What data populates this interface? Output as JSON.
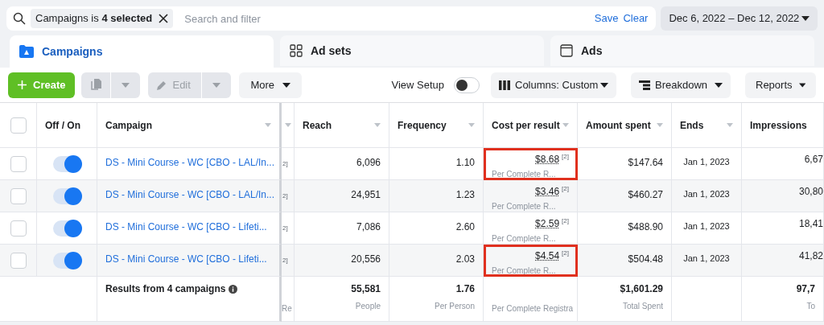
{
  "filter_bar": {
    "chip_label": "Campaigns is ",
    "chip_value": "4 selected",
    "placeholder": "Search and filter",
    "save": "Save",
    "clear": "Clear",
    "date_range": "Dec 6, 2022 – Dec 12, 2022"
  },
  "tabs": [
    {
      "label": "Campaigns",
      "selected": true
    },
    {
      "label": "Ad sets",
      "selected": false
    },
    {
      "label": "Ads",
      "selected": false
    }
  ],
  "toolbar": {
    "create": "Create",
    "edit": "Edit",
    "more": "More",
    "view_setup": {
      "label": "View Setup",
      "on": false
    },
    "columns": "Columns: Custom",
    "breakdown": "Breakdown",
    "reports": "Reports"
  },
  "table": {
    "select_all": {
      "checked": false
    },
    "columns": [
      "Off / On",
      "Campaign",
      "Reach",
      "Frequency",
      "Cost per result",
      "Amount spent",
      "Ends",
      "Impressions"
    ],
    "rows": [
      {
        "checked": false,
        "on": true,
        "campaign": "DS - Mini Course - WC [CBO - LAL/In...",
        "column_3": "2]",
        "reach": "6,096",
        "frequency": "1.10",
        "cost": "$8.68",
        "cost_note": "[2]",
        "cost_sub": "Per Complete R...",
        "highlighted": true,
        "amount": "$147.64",
        "ends": "Jan 1, 2023",
        "impressions": "6,67"
      },
      {
        "checked": false,
        "on": true,
        "campaign": "DS - Mini Course - WC [CBO - LAL/In...",
        "column_3": "2]",
        "reach": "24,951",
        "frequency": "1.23",
        "cost": "$3.46",
        "cost_note": "[2]",
        "cost_sub": "Per Complete R...",
        "highlighted": false,
        "amount": "$460.27",
        "ends": "Jan 1, 2023",
        "impressions": "30,80"
      },
      {
        "checked": false,
        "on": true,
        "campaign": "DS - Mini Course - WC [CBO - Lifeti...",
        "column_3": "2]",
        "reach": "7,086",
        "frequency": "2.60",
        "cost": "$2.59",
        "cost_note": "[2]",
        "cost_sub": "Per Complete R...",
        "highlighted": false,
        "amount": "$488.90",
        "ends": "Jan 1, 2023",
        "impressions": "18,41"
      },
      {
        "checked": false,
        "on": true,
        "campaign": "DS - Mini Course - WC [CBO - Lifeti...",
        "column_3": "2]",
        "reach": "20,556",
        "frequency": "2.03",
        "cost": "$4.54",
        "cost_note": "[2]",
        "cost_sub": "Per Complete R...",
        "highlighted": true,
        "amount": "$504.48",
        "ends": "Jan 1, 2023",
        "impressions": "41,82"
      }
    ],
    "footer": {
      "label": "Results from 4 campaigns",
      "column_3": "Re",
      "reach": "55,581",
      "reach_sub": "People",
      "frequency": "1.76",
      "frequency_sub": "Per Person",
      "cost_sub": "Per Complete Registra",
      "amount": "$1,601.29",
      "amount_sub": "Total Spent",
      "impressions": "97,7",
      "impressions_sub": "To"
    }
  }
}
